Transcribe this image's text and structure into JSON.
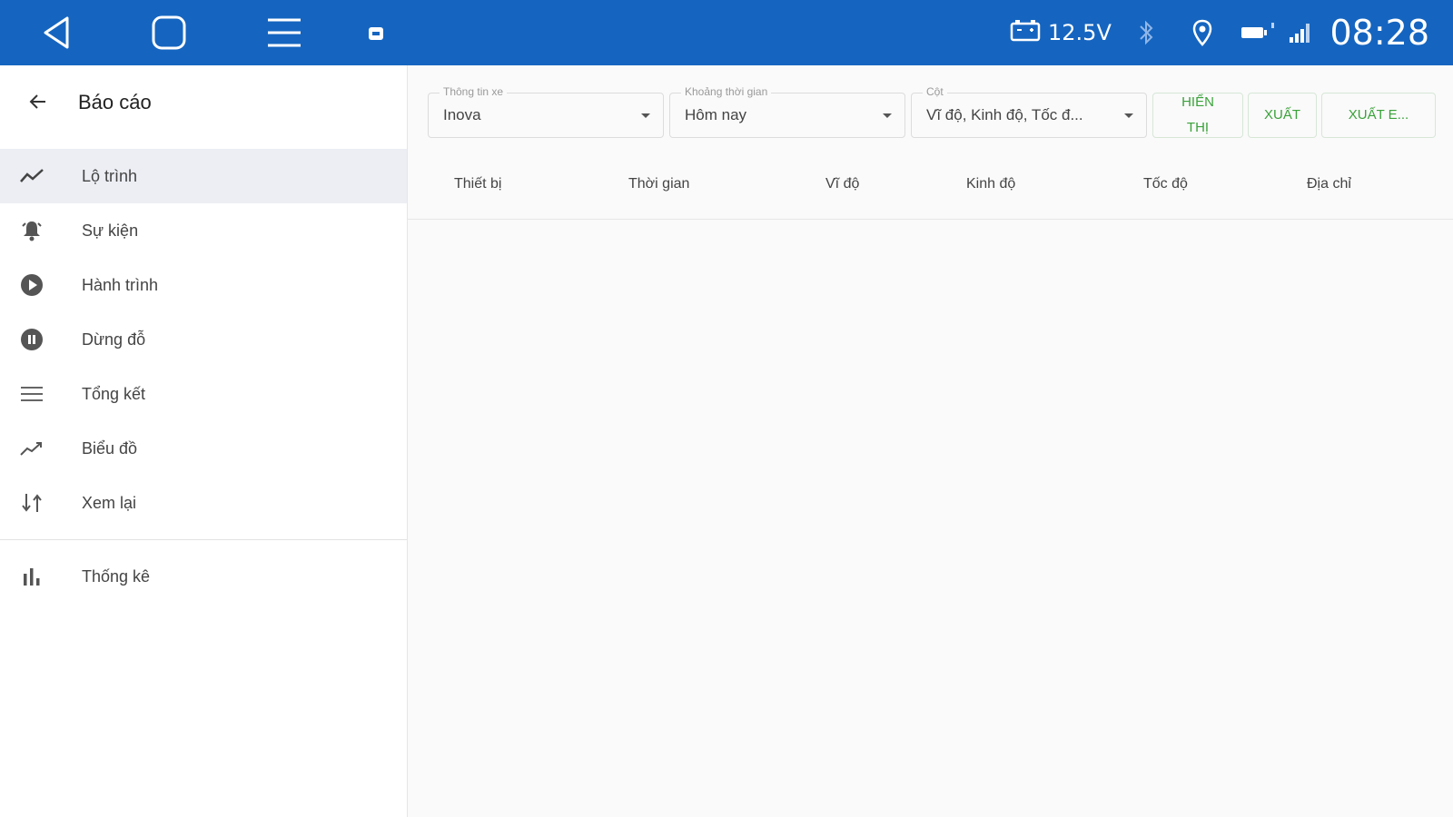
{
  "statusbar": {
    "voltage": "12.5V",
    "time": "08:28",
    "icons": [
      "back-triangle-icon",
      "home-square-icon",
      "menu-icon",
      "app-icon",
      "car-battery-icon",
      "bluetooth-icon",
      "location-pin-icon",
      "network-icon",
      "signal-icon"
    ]
  },
  "sidebar": {
    "title": "Báo cáo",
    "items": [
      {
        "label": "Lộ trình",
        "icon": "route-icon",
        "active": true
      },
      {
        "label": "Sự kiện",
        "icon": "bell-icon"
      },
      {
        "label": "Hành trình",
        "icon": "play-circle-icon"
      },
      {
        "label": "Dừng đỗ",
        "icon": "pause-circle-icon"
      },
      {
        "label": "Tổng kết",
        "icon": "list-icon"
      },
      {
        "label": "Biểu đồ",
        "icon": "trend-icon"
      },
      {
        "label": "Xem lại",
        "icon": "replay-icon"
      },
      {
        "label": "Thống kê",
        "icon": "bar-chart-icon"
      }
    ]
  },
  "filters": {
    "vehicle": {
      "label": "Thông tin xe",
      "value": "Inova"
    },
    "period": {
      "label": "Khoảng thời gian",
      "value": "Hôm nay"
    },
    "columns": {
      "label": "Cột",
      "value": "Vĩ độ, Kinh độ, Tốc đ..."
    },
    "buttons": {
      "show": "HIỂN THỊ",
      "export": "XUẤT",
      "export_excel": "XUẤT E..."
    }
  },
  "table": {
    "headers": [
      "Thiết bị",
      "Thời gian",
      "Vĩ độ",
      "Kinh độ",
      "Tốc độ",
      "Địa chỉ"
    ]
  },
  "colors": {
    "statusbar": "#1565c0",
    "accent_green": "#3aa23a",
    "active_bg": "#eceef4"
  }
}
